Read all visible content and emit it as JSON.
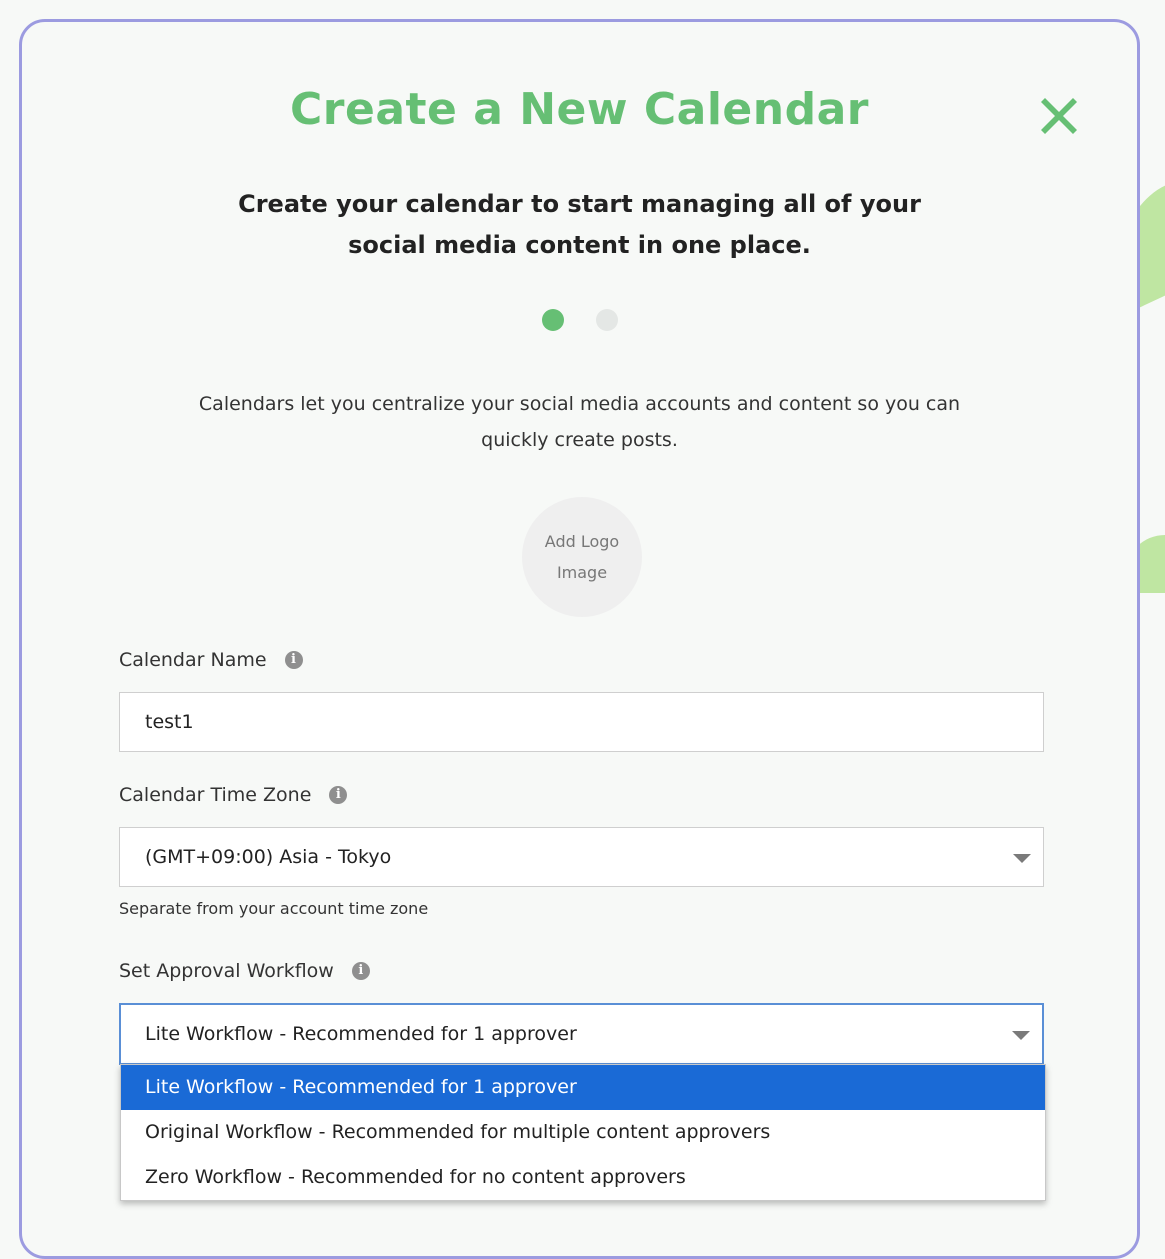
{
  "modal": {
    "title": "Create a New Calendar",
    "close_icon": "close-x-icon",
    "subtitle_line1": "Create your calendar to start managing all of your",
    "subtitle_line2": "social media content in one place.",
    "steps": {
      "current": 1,
      "total": 2
    },
    "description_line1": "Calendars let you centralize your social media accounts and content so you can",
    "description_line2": "quickly create posts.",
    "logo_upload": {
      "line1": "Add Logo",
      "line2": "Image"
    }
  },
  "form": {
    "calendar_name": {
      "label": "Calendar Name",
      "value": "test1",
      "icon": "info-icon"
    },
    "time_zone": {
      "label": "Calendar Time Zone",
      "value": "(GMT+09:00) Asia - Tokyo",
      "help": "Separate from your account time zone",
      "icon": "info-icon"
    },
    "workflow": {
      "label": "Set Approval Workflow",
      "value": "Lite Workflow - Recommended for 1 approver",
      "icon": "info-icon",
      "options": [
        "Lite Workflow - Recommended for 1 approver",
        "Original Workflow - Recommended for multiple content approvers",
        "Zero Workflow - Recommended for no content approvers"
      ],
      "selected_index": 0
    }
  },
  "colors": {
    "accent": "#66bf74",
    "modal_border": "#9c9be0",
    "selection": "#1a6ad6"
  }
}
